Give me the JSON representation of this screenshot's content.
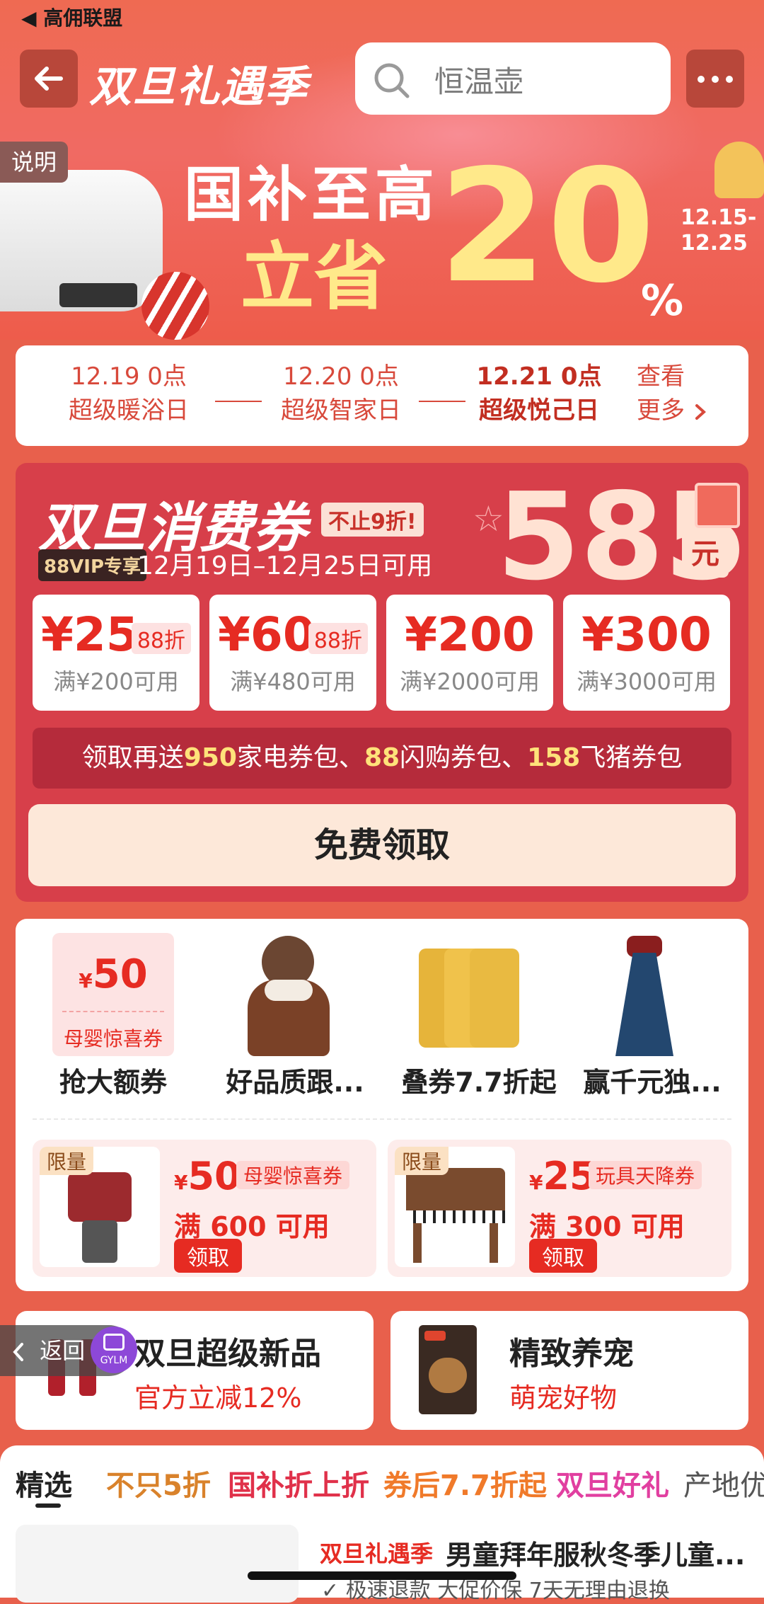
{
  "status": {
    "back_app": "◀ 高佣联盟"
  },
  "header": {
    "logo": "双旦礼遇季",
    "search_placeholder": "恒温壶"
  },
  "banner": {
    "desc_tag": "说明",
    "line1": "国补至高",
    "line2": "立省",
    "big_number": "20",
    "percent": "%",
    "date_range_1": "12.15-",
    "date_range_2": "12.25"
  },
  "schedule": {
    "items": [
      {
        "date": "12.19 0点",
        "name": "超级暖浴日"
      },
      {
        "date": "12.20 0点",
        "name": "超级智家日"
      },
      {
        "date": "12.21 0点",
        "name": "超级悦己日"
      }
    ],
    "more_1": "查看",
    "more_2": "更多"
  },
  "coupon": {
    "title": "双旦消费券",
    "badge": "不止9折!",
    "vip": "88VIP专享",
    "dates": "12月19日–12月25日可用",
    "total": "585",
    "unit": "元",
    "tiles": [
      {
        "amount": "¥25",
        "discount": "88折",
        "condition": "满¥200可用"
      },
      {
        "amount": "¥60",
        "discount": "88折",
        "condition": "满¥480可用"
      },
      {
        "amount": "¥200",
        "discount": "",
        "condition": "满¥2000可用"
      },
      {
        "amount": "¥300",
        "discount": "",
        "condition": "满¥3000可用"
      }
    ],
    "strip": {
      "p1": "领取再送",
      "n1": "950",
      "p2": "家电券包、",
      "n2": "88",
      "p3": "闪购券包、",
      "n3": "158",
      "p4": "飞猪券包"
    },
    "claim": "免费领取"
  },
  "categories": {
    "items": [
      {
        "label": "抢大额券",
        "coupon_symbol": "¥",
        "coupon_value": "50",
        "coupon_sub": "母婴惊喜券"
      },
      {
        "label": "好品质跟..."
      },
      {
        "label": "叠券7.7折起"
      },
      {
        "label": "赢千元独..."
      }
    ],
    "promos": [
      {
        "limit": "限量",
        "symbol": "¥",
        "amount": "50",
        "tag": "母婴惊喜券",
        "full": "满 600 可用",
        "button": "领取"
      },
      {
        "limit": "限量",
        "symbol": "¥",
        "amount": "25",
        "tag": "玩具天降券",
        "full": "满 300 可用",
        "button": "领取"
      }
    ]
  },
  "bottom_cards": [
    {
      "title": "双旦超级新品",
      "subtitle": "官方立减12%"
    },
    {
      "title": "精致养宠",
      "subtitle": "萌宠好物"
    }
  ],
  "overlay": {
    "return": "返回",
    "gylm": "GYLM"
  },
  "tabs": [
    {
      "label": "精选",
      "color": "#222222"
    },
    {
      "label": "不只5折",
      "color": "#d9822b"
    },
    {
      "label": "国补折上折",
      "color": "#e0314a"
    },
    {
      "label": "券后7.7折起",
      "color": "#f07a2a"
    },
    {
      "label": "双旦好礼",
      "color": "#e13fa0"
    },
    {
      "label": "产地优",
      "color": "#555555"
    }
  ],
  "product": {
    "brand": "双旦礼遇季",
    "title": "男童拜年服秋冬季儿童...",
    "tags": "极速退款  大促价保  7天无理由退换"
  },
  "colors": {
    "accent": "#e62b22",
    "coupon_panel": "#d73f4a",
    "page_bg": "#e8604c"
  }
}
